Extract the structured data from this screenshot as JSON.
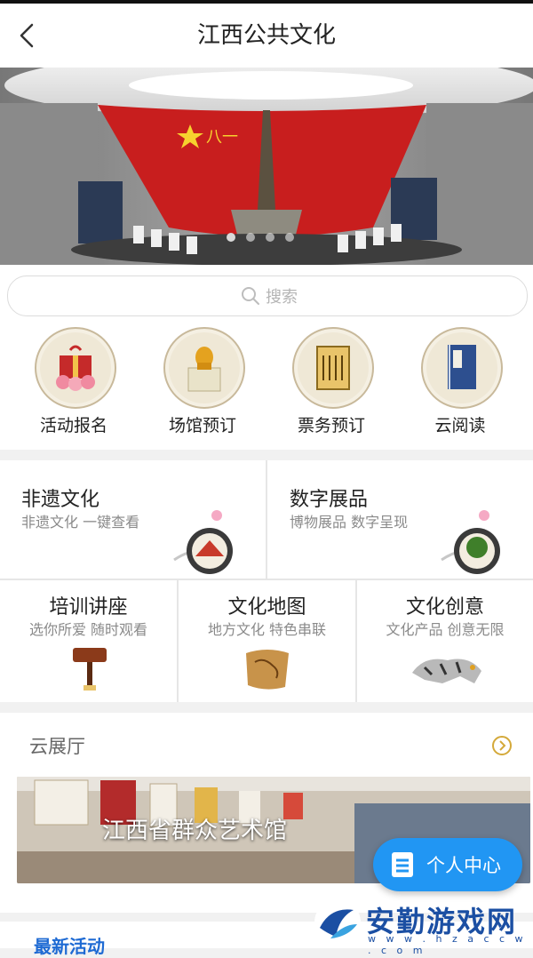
{
  "header": {
    "title": "江西公共文化"
  },
  "search": {
    "placeholder": "搜索"
  },
  "quick_actions": [
    {
      "label": "活动报名",
      "icon": "gift-icon"
    },
    {
      "label": "场馆预订",
      "icon": "trophy-box-icon"
    },
    {
      "label": "票务预订",
      "icon": "ticket-icon"
    },
    {
      "label": "云阅读",
      "icon": "book-icon"
    }
  ],
  "features": [
    {
      "title": "非遗文化",
      "subtitle": "非遗文化 一键查看",
      "icon": "fan-icon"
    },
    {
      "title": "数字展品",
      "subtitle": "博物展品 数字呈现",
      "icon": "bonsai-icon"
    },
    {
      "title": "培训讲座",
      "subtitle": "选你所爱 随时观看",
      "icon": "gavel-icon"
    },
    {
      "title": "文化地图",
      "subtitle": "地方文化 特色串联",
      "icon": "map-icon"
    },
    {
      "title": "文化创意",
      "subtitle": "文化产品 创意无限",
      "icon": "tiger-icon"
    }
  ],
  "cloud_hall": {
    "title": "云展厅",
    "caption": "江西省群众艺术馆"
  },
  "user_center": {
    "label": "个人中心"
  },
  "latest": {
    "title": "最新活动"
  },
  "watermark": {
    "text": "安勤游戏网",
    "url": "w w w . h z a c c w . c o m"
  },
  "colors": {
    "accent": "#2196f3",
    "gold": "#d4a93a",
    "banner_red": "#d32323"
  }
}
